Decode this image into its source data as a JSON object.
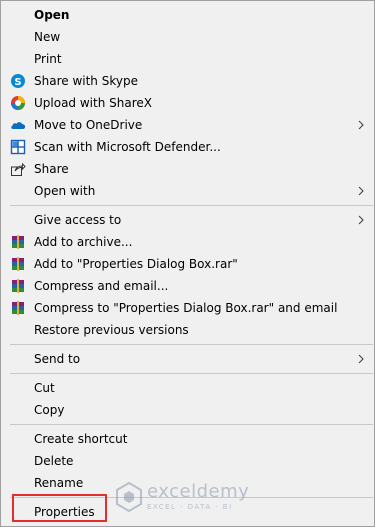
{
  "menu": {
    "open": "Open",
    "new": "New",
    "print": "Print",
    "share_skype": "Share with Skype",
    "upload_sharex": "Upload with ShareX",
    "move_onedrive": "Move to OneDrive",
    "scan_defender": "Scan with Microsoft Defender...",
    "share": "Share",
    "open_with": "Open with",
    "give_access": "Give access to",
    "add_archive": "Add to archive...",
    "add_rar": "Add to \"Properties Dialog Box.rar\"",
    "compress_email": "Compress and email...",
    "compress_rar_email": "Compress to \"Properties Dialog Box.rar\" and email",
    "restore_versions": "Restore previous versions",
    "send_to": "Send to",
    "cut": "Cut",
    "copy": "Copy",
    "create_shortcut": "Create shortcut",
    "delete": "Delete",
    "rename": "Rename",
    "properties": "Properties"
  },
  "icons": {
    "share_skype": "skype-icon",
    "upload_sharex": "sharex-icon",
    "move_onedrive": "onedrive-icon",
    "scan_defender": "defender-icon",
    "share": "share-icon",
    "winrar": "winrar-icon",
    "submenu": "chevron-right-icon"
  },
  "watermark": {
    "name": "exceldemy",
    "tagline": "EXCEL · DATA · BI"
  },
  "colors": {
    "menu_bg": "#f0f0f0",
    "separator": "#c8c8c8",
    "highlight_border": "#e0302c",
    "skype_blue": "#0a8ad6",
    "onedrive_blue": "#0f6cbd"
  }
}
